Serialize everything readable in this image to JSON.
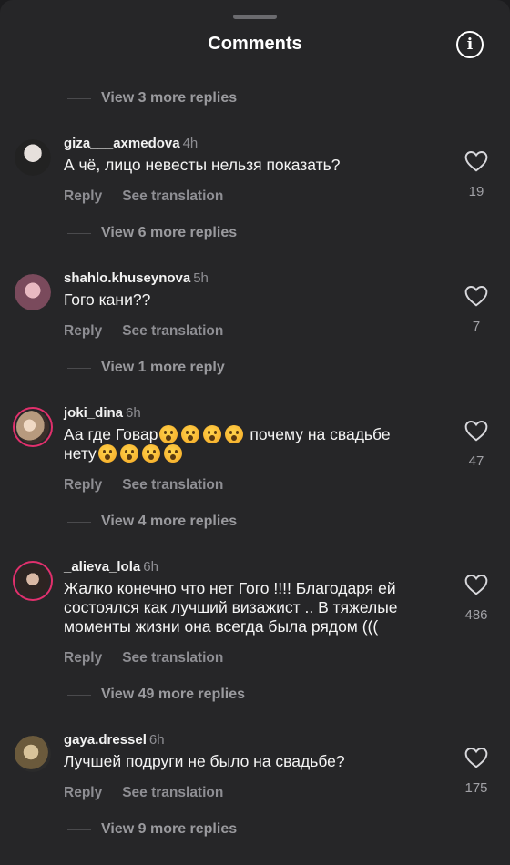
{
  "header": {
    "title": "Comments",
    "info_icon": "info-icon",
    "info_glyph": "i"
  },
  "replies_top": "View 3 more replies",
  "actions": {
    "reply": "Reply",
    "translate": "See translation"
  },
  "comments": [
    {
      "username": "giza___axmedova",
      "time": "4h",
      "text": "А чё,  лицо невесты нельзя показать?",
      "likes": "19",
      "replies": "View 6 more replies",
      "avatar_color": "#cfcfcf",
      "avatar_ring": false,
      "emoji_run_1": 0,
      "text_tail_1": "",
      "emoji_run_2": 0,
      "text_tail_2": ""
    },
    {
      "username": "shahlo.khuseynova",
      "time": "5h",
      "text": "Гого кани??",
      "likes": "7",
      "replies": "View 1 more reply",
      "avatar_color": "#b07a8c",
      "avatar_ring": false
    },
    {
      "username": "joki_dina",
      "time": "6h",
      "text": "Аа где Говар",
      "text_tail_1": "почему на свадьбе",
      "text_tail_2": "нету",
      "emoji_run_1": 4,
      "emoji_run_2": 4,
      "likes": "47",
      "replies": "View 4 more replies",
      "avatar_color": "#c7b299",
      "avatar_ring": true
    },
    {
      "username": "_alieva_lola",
      "time": "6h",
      "text": "Жалко конечно что нет Гого !!!! Благодаря ей состоялся как лучший визажист .. В тяжелые моменты жизни она всегда была рядом (((",
      "likes": "486",
      "replies": "View 49 more replies",
      "avatar_color": "#6f5b55",
      "avatar_ring": true
    },
    {
      "username": "gaya.dressel",
      "time": "6h",
      "text": "Лучшей подруги не было на свадьбе?",
      "likes": "175",
      "replies": "View 9 more replies",
      "avatar_color": "#9c8f6e",
      "avatar_ring": false
    }
  ]
}
